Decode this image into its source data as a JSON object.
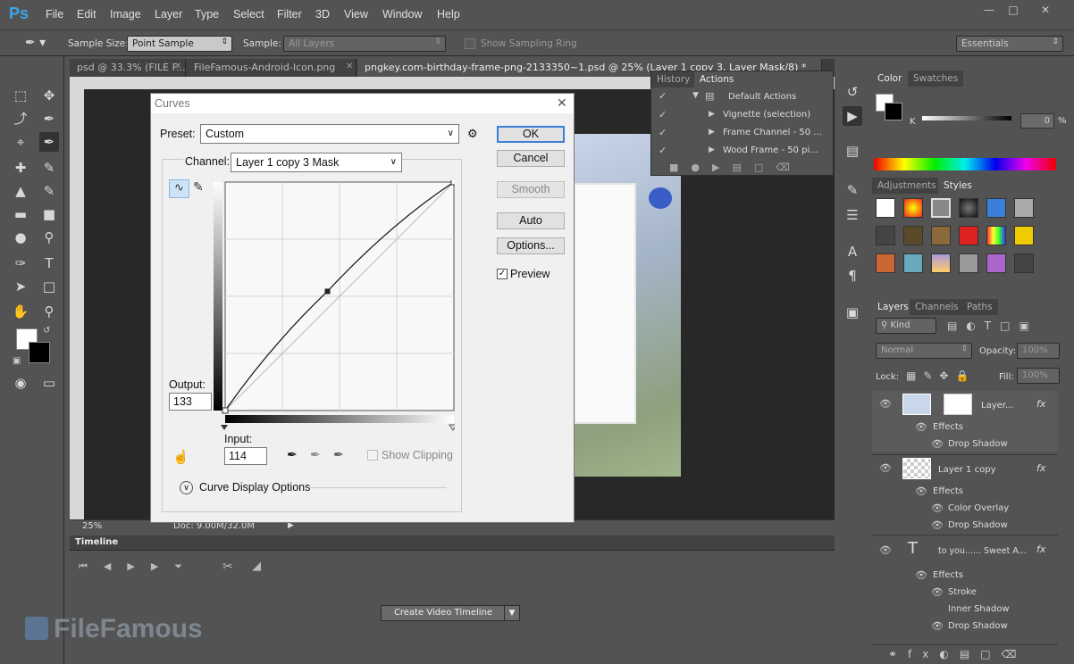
{
  "app": {
    "logo": "Ps"
  },
  "menu": [
    "File",
    "Edit",
    "Image",
    "Layer",
    "Type",
    "Select",
    "Filter",
    "3D",
    "View",
    "Window",
    "Help"
  ],
  "options": {
    "sample_size_label": "Sample Size:",
    "sample_size_value": "Point Sample",
    "sample_label": "Sample:",
    "sample_value": "All Layers",
    "show_ring": "Show Sampling Ring",
    "workspace": "Essentials"
  },
  "doc_tabs": [
    "psd @ 33.3% (FILE F...",
    "FileFamous-Android-Icon.png",
    "pngkey.com-birthday-frame-png-2133350~1.psd @ 25% (Layer 1 copy 3, Layer Mask/8) *"
  ],
  "status": {
    "zoom": "25%",
    "doc": "Doc: 9.00M/32.0M"
  },
  "timeline": {
    "tab": "Timeline",
    "button": "Create Video Timeline"
  },
  "dialog": {
    "title": "Curves",
    "preset_label": "Preset:",
    "preset_value": "Custom",
    "channel_label": "Channel:",
    "channel_value": "Layer 1 copy 3 Mask",
    "output_label": "Output:",
    "output_value": "133",
    "input_label": "Input:",
    "input_value": "114",
    "show_clipping": "Show Clipping",
    "curve_display": "Curve Display Options",
    "buttons": {
      "ok": "OK",
      "cancel": "Cancel",
      "smooth": "Smooth",
      "auto": "Auto",
      "options": "Options..."
    },
    "preview": "Preview",
    "curve_point": {
      "input": 114,
      "output": 133
    }
  },
  "history": {
    "tabs": [
      "History",
      "Actions"
    ],
    "items": [
      "Default Actions",
      "Vignette (selection)",
      "Frame Channel - 50 ...",
      "Wood Frame - 50 pi..."
    ]
  },
  "color_panel": {
    "tabs": [
      "Color",
      "Swatches"
    ],
    "k_label": "K",
    "k_value": "0",
    "k_unit": "%"
  },
  "styles_panel": {
    "tabs": [
      "Adjustments",
      "Styles"
    ]
  },
  "layers_panel": {
    "tabs": [
      "Layers",
      "Channels",
      "Paths"
    ],
    "kind": "Kind",
    "blend_mode": "Normal",
    "opacity_label": "Opacity:",
    "opacity_value": "100%",
    "lock_label": "Lock:",
    "fill_label": "Fill:",
    "fill_value": "100%",
    "layers": [
      {
        "name": "Layer...",
        "effects_label": "Effects",
        "effects": [
          "Drop Shadow"
        ]
      },
      {
        "name": "Layer 1 copy",
        "effects_label": "Effects",
        "effects": [
          "Color Overlay",
          "Drop Shadow"
        ]
      },
      {
        "name": "to you...... Sweet A...",
        "effects_label": "Effects",
        "effects": [
          "Stroke",
          "Inner Shadow",
          "Drop Shadow"
        ]
      }
    ]
  },
  "watermark": "FileFamous",
  "colors": {
    "accent": "#3c7fd6",
    "panel": "#535353",
    "canvas": "#282828"
  }
}
